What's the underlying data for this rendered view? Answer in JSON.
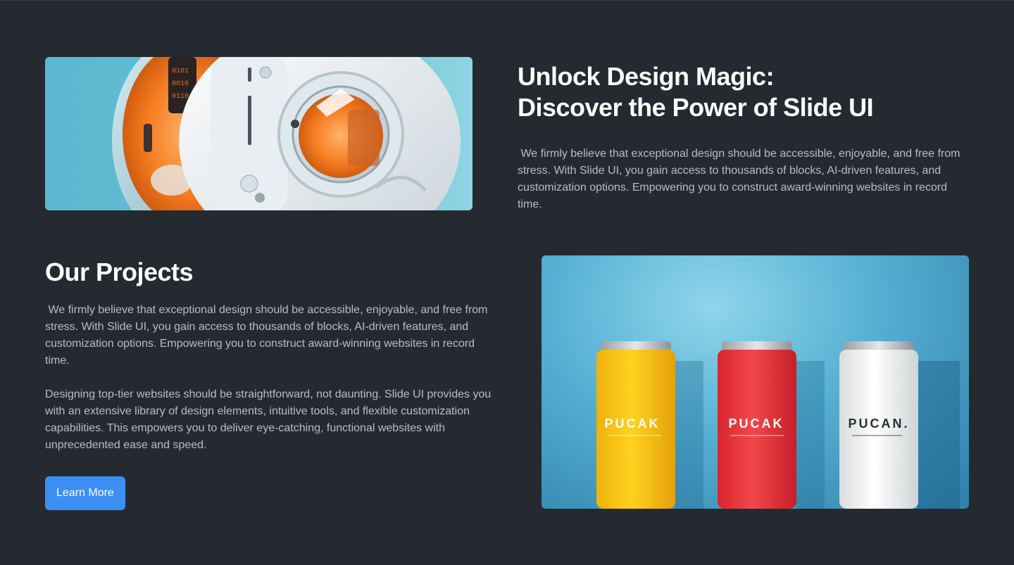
{
  "hero": {
    "title_line1": "Unlock Design Magic:",
    "title_line2": "Discover the Power of Slide UI",
    "body": " We firmly believe that exceptional design should be accessible, enjoyable, and free from stress. With Slide UI, you gain access to thousands of blocks, AI-driven features, and customization options. Empowering you to construct award-winning websites in record time.",
    "image": "robot-illustration"
  },
  "projects": {
    "title": "Our Projects",
    "body_1": " We firmly believe that exceptional design should be accessible, enjoyable, and free from stress. With Slide UI, you gain access to thousands of blocks, AI-driven features, and customization options. Empowering you to construct award-winning websites in record time.",
    "body_2": "Designing top-tier websites should be straightforward, not daunting. Slide UI provides you with an extensive library of design elements, intuitive tools, and flexible customization capabilities. This empowers you to deliver eye-catching, functional websites with unprecedented ease and speed.",
    "cta_label": "Learn More",
    "image": "cans-photo"
  },
  "cans": {
    "labels": [
      "PUCAK",
      "PUCAK",
      "PUCAN."
    ]
  },
  "colors": {
    "background": "#252a31",
    "accent": "#3b8ff5",
    "text_muted": "#b9bec6"
  }
}
